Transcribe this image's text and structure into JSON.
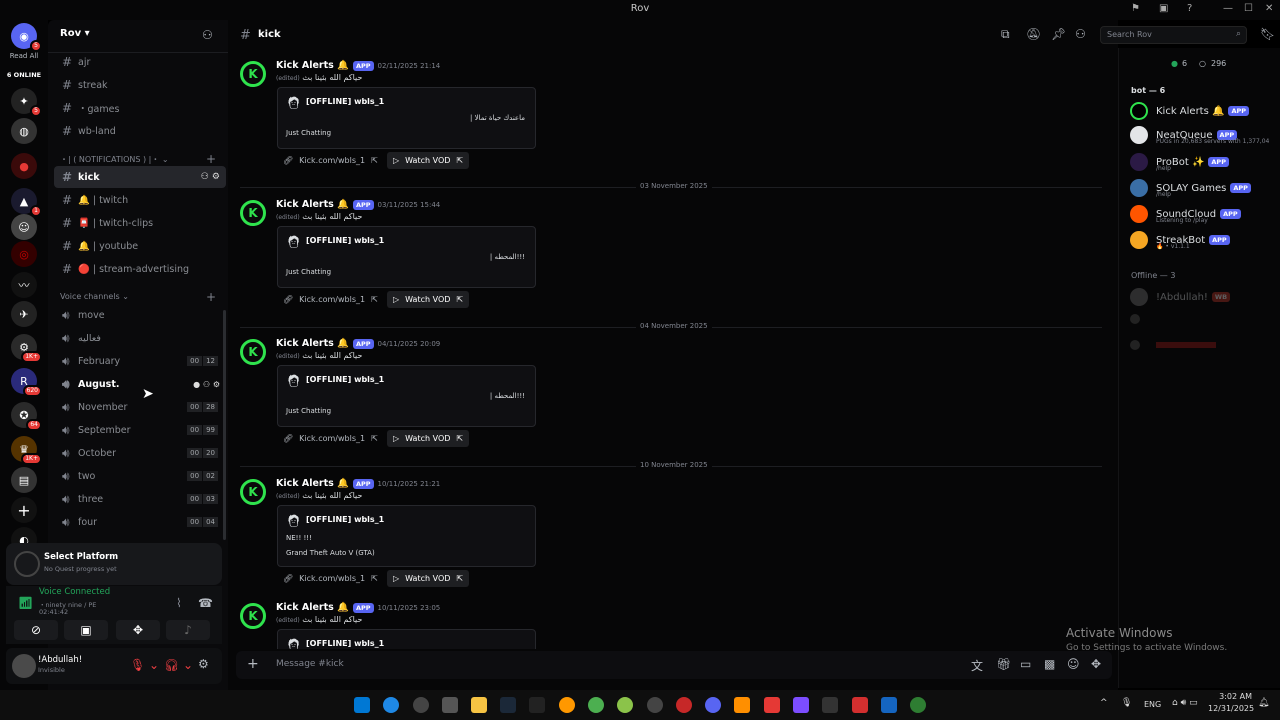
{
  "window": {
    "title": "Rov"
  },
  "servers": {
    "read_all": "Read All",
    "online": "6 ONLINE",
    "badges": [
      "5",
      "5",
      "1",
      "1K+",
      "620",
      "64",
      "1K+"
    ]
  },
  "guild": {
    "name": "Rov"
  },
  "channels": [
    {
      "name": "ajr"
    },
    {
      "name": "streak"
    },
    {
      "name": "・games"
    },
    {
      "name": "wb-land"
    }
  ],
  "categories": {
    "notifications": "・| ( NOTIFICATIONS ) |・",
    "voice": "Voice channels"
  },
  "notif_channels": [
    {
      "name": "kick",
      "selected": true
    },
    {
      "name": "🔔 | twitch"
    },
    {
      "name": "📮 | twitch-clips"
    },
    {
      "name": "🔔 | youtube"
    },
    {
      "name": "🔴 | stream-advertising"
    }
  ],
  "voice_channels": [
    {
      "name": "move",
      "a": "",
      "b": ""
    },
    {
      "name": "فعاليه",
      "a": "",
      "b": ""
    },
    {
      "name": "February",
      "a": "00",
      "b": "12"
    },
    {
      "name": "August.",
      "a": "",
      "b": ""
    },
    {
      "name": "November",
      "a": "00",
      "b": "28"
    },
    {
      "name": "September",
      "a": "00",
      "b": "99"
    },
    {
      "name": "October",
      "a": "00",
      "b": "20"
    },
    {
      "name": "two",
      "a": "00",
      "b": "02"
    },
    {
      "name": "three",
      "a": "00",
      "b": "03"
    },
    {
      "name": "four",
      "a": "00",
      "b": "04"
    }
  ],
  "quest": {
    "title": "Select Platform",
    "sub": "No Quest progress yet"
  },
  "voice": {
    "status": "Voice Connected",
    "channel": "ninety nine / PE",
    "time": "02:41:42"
  },
  "user": {
    "name": "!Abdullah!",
    "status": "Invisible"
  },
  "header": {
    "channel": "kick",
    "search_placeholder": "Search Rov"
  },
  "messages": [
    {
      "author": "Kick Alerts 🔔",
      "app": "APP",
      "time": "02/11/2025 21:14",
      "edited": "(edited)",
      "text": "حياكم الله بثينا بث",
      "embed_title": "[OFFLINE] wbls_1",
      "embed_line": "| ماعندك حياة تمالا",
      "embed_game": "Just Chatting",
      "link": "Kick.com/wbls_1",
      "vod": "Watch VOD"
    },
    {
      "author": "Kick Alerts 🔔",
      "app": "APP",
      "time": "03/11/2025 15:44",
      "edited": "(edited)",
      "text": "حياكم الله بثينا بث",
      "embed_title": "[OFFLINE] wbls_1",
      "embed_line": "| المحطه!!!",
      "embed_game": "Just Chatting",
      "link": "Kick.com/wbls_1",
      "vod": "Watch VOD"
    },
    {
      "author": "Kick Alerts 🔔",
      "app": "APP",
      "time": "04/11/2025 20:09",
      "edited": "(edited)",
      "text": "حياكم الله بثينا بث",
      "embed_title": "[OFFLINE] wbls_1",
      "embed_line": "| المحطه!!!",
      "embed_game": "Just Chatting",
      "link": "Kick.com/wbls_1",
      "vod": "Watch VOD"
    },
    {
      "author": "Kick Alerts 🔔",
      "app": "APP",
      "time": "10/11/2025 21:21",
      "edited": "(edited)",
      "text": "حياكم الله بثينا بث",
      "embed_title": "[OFFLINE] wbls_1",
      "embed_line": "NE!! !!!",
      "embed_game": "Grand Theft Auto V (GTA)",
      "link": "Kick.com/wbls_1",
      "vod": "Watch VOD"
    },
    {
      "author": "Kick Alerts 🔔",
      "app": "APP",
      "time": "10/11/2025 23:05",
      "edited": "(edited)",
      "text": "حياكم الله بثينا بث",
      "embed_title": "[OFFLINE] wbls_1"
    }
  ],
  "dividers": [
    "03 November 2025",
    "04 November 2025",
    "10 November 2025"
  ],
  "composer": {
    "placeholder": "Message #kick"
  },
  "member_list": {
    "online_count": "6",
    "total_count": "296",
    "bot_header": "bot — 6",
    "offline_header": "Offline — 3",
    "bots": [
      {
        "name": "Kick Alerts 🔔",
        "badge": "APP",
        "sub": "",
        "color": "#2fe34d"
      },
      {
        "name": "NeatQueue",
        "badge": "APP",
        "sub": "PUGs in 20,683 servers with 1,377,04",
        "color": "#e3e5e8"
      },
      {
        "name": "ProBot ✨",
        "badge": "APP",
        "sub": "/help",
        "color": "#2b1a45"
      },
      {
        "name": "SOLAY Games",
        "badge": "APP",
        "sub": "/help",
        "color": "#3a6ea5"
      },
      {
        "name": "SoundCloud",
        "badge": "APP",
        "sub": "Listening to /play",
        "color": "#ff5500"
      },
      {
        "name": "StreakBot",
        "badge": "APP",
        "sub": "🔥 • v1.1.1",
        "color": "#f5a623"
      }
    ],
    "offline": [
      {
        "name": "!Abdullah!",
        "badge": "WB"
      }
    ]
  },
  "watermark": {
    "title": "Activate Windows",
    "sub": "Go to Settings to activate Windows."
  },
  "taskbar": {
    "lang": "ENG",
    "time": "3:02 AM",
    "date": "12/31/2025"
  }
}
